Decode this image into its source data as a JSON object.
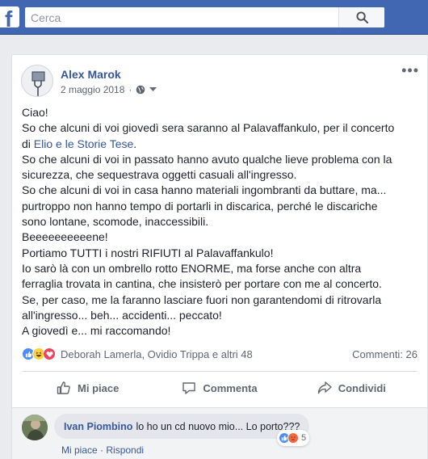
{
  "topbar": {
    "logo": "f",
    "search_placeholder": "Cerca"
  },
  "post": {
    "author": "Alex Marok",
    "date": "2 maggio 2018",
    "more": "•••",
    "privacy_icon": "globe-icon",
    "text": {
      "line1": "Ciao!",
      "line2": "So che alcuni di voi giovedì sera saranno al Palavaffankulo, per il concerto",
      "line3_pre": "di ",
      "line3_link": "Elio e le Storie Tese",
      "line3_post": ".",
      "line4": "So che alcuni di voi in passato hanno avuto qualche lieve problema con la",
      "line5": "sicurezza, che sequestrava oggetti casuali all'ingresso.",
      "line6": "So che alcuni di voi in casa hanno materiali ingombranti da buttare, ma...",
      "line7": "purtroppo non hanno tempo di portarli in discarica, perché le discariche",
      "line8": "sono lontane, scomode, inaccessibili.",
      "line9": "Beeeeeeeeeene!",
      "line10": "Portiamo TUTTI i nostri RIFIUTI al Palavaffankulo!",
      "line11": "Io sarò là con un ombrello rotto ENORME, ma forse anche con altra",
      "line12": "ferraglia trovata in cantina, che insisterò per portare con me al concerto.",
      "line13": "Se, per caso, me la faranno lasciare fuori non garantendomi di ritrovarla",
      "line14": "all'ingresso... beh... accidenti... peccato!",
      "line15": "A giovedì e... mi raccomando!"
    },
    "reactions": {
      "icons": [
        "like-reaction-icon",
        "haha-reaction-icon",
        "love-reaction-icon"
      ],
      "names": "Deborah Lamerla, Ovidio Trippa e altri 48",
      "comments": "Commenti: 26"
    },
    "actions": {
      "like": "Mi piace",
      "comment": "Commenta",
      "share": "Condividi"
    }
  },
  "comment": {
    "author": "Ivan Piombino",
    "text": "lo ho un cd nuovo mio... Lo porto???",
    "like_link": "Mi piace",
    "separator": "·",
    "reply_link": "Rispondi",
    "reaction_count": "5"
  },
  "colors": {
    "brand": "#4267b2",
    "link": "#365899",
    "background": "#e9ebee"
  }
}
